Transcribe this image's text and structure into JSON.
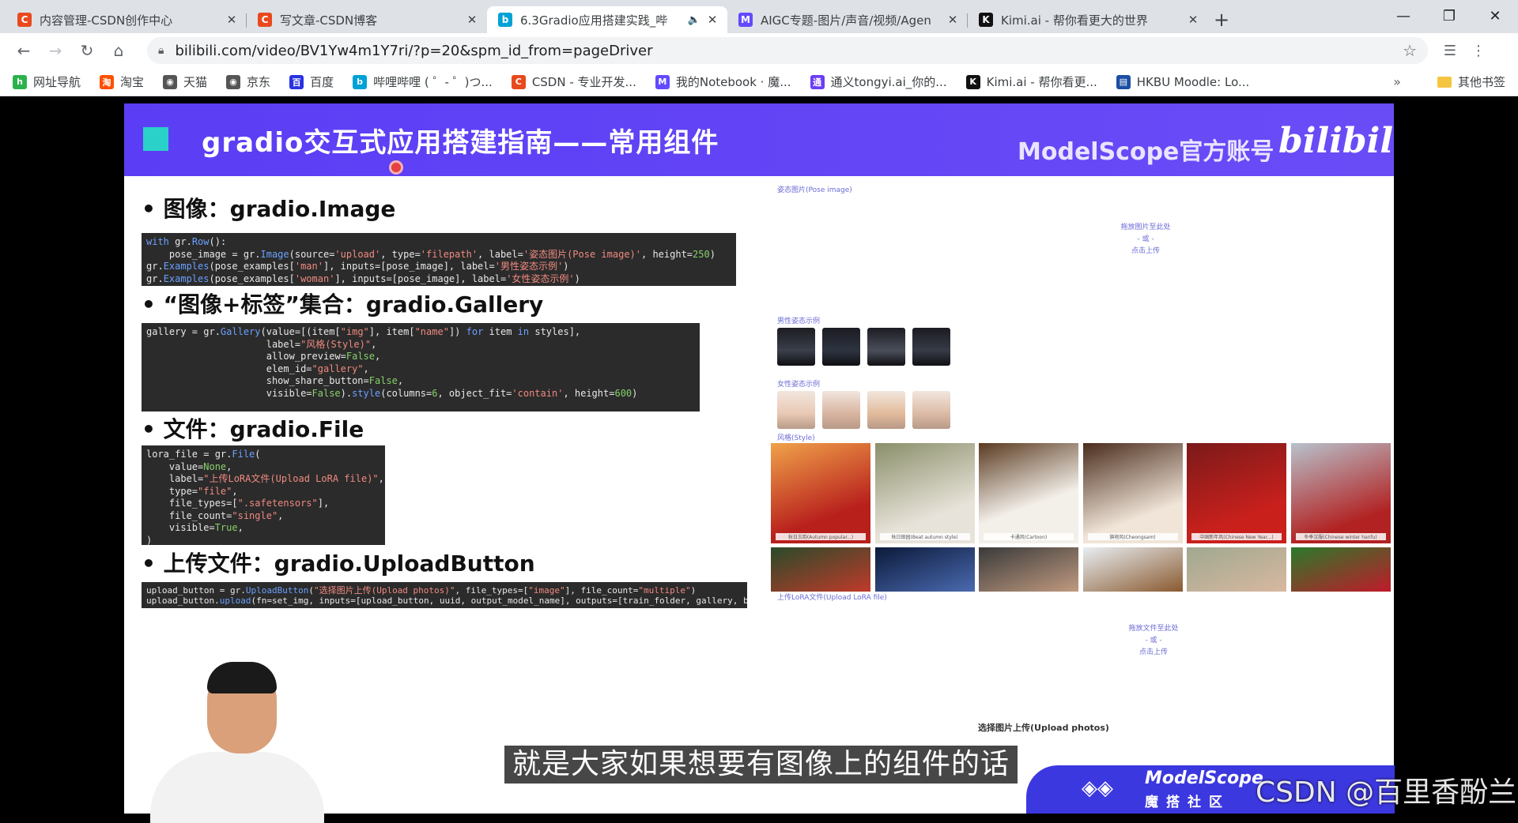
{
  "browser": {
    "tabs": [
      {
        "title": "内容管理-CSDN创作中心",
        "icon": "csdn-icon",
        "icon_color": "#e9491f",
        "icon_letter": "C"
      },
      {
        "title": "写文章-CSDN博客",
        "icon": "csdn-icon",
        "icon_color": "#e9491f",
        "icon_letter": "C"
      },
      {
        "title": "6.3Gradio应用搭建实践_哔",
        "icon": "bilibili-icon",
        "icon_color": "#00a1d6",
        "icon_letter": "b",
        "active": true,
        "audio": true
      },
      {
        "title": "AIGC专题-图片/声音/视频/Agen",
        "icon": "modelscope-icon",
        "icon_color": "#624aff",
        "icon_letter": "M"
      },
      {
        "title": "Kimi.ai - 帮你看更大的世界",
        "icon": "kimi-icon",
        "icon_color": "#111111",
        "icon_letter": "K"
      }
    ],
    "url": "bilibili.com/video/BV1Yw4m1Y7ri/?p=20&spm_id_from=pageDriver",
    "bookmarks": [
      {
        "label": "网址导航",
        "icon": "hao123-icon",
        "color": "#2bb24c",
        "letter": "h"
      },
      {
        "label": "淘宝",
        "icon": "taobao-icon",
        "color": "#ff5000",
        "letter": "淘"
      },
      {
        "label": "天猫",
        "icon": "globe-icon",
        "color": "#555555",
        "letter": "◉"
      },
      {
        "label": "京东",
        "icon": "globe-icon",
        "color": "#555555",
        "letter": "◉"
      },
      {
        "label": "百度",
        "icon": "baidu-icon",
        "color": "#2932e1",
        "letter": "百"
      },
      {
        "label": "哔哩哔哩 ( ゜- ゜)つ...",
        "icon": "bilibili-icon",
        "color": "#00a1d6",
        "letter": "b"
      },
      {
        "label": "CSDN - 专业开发...",
        "icon": "csdn-icon",
        "color": "#e9491f",
        "letter": "C"
      },
      {
        "label": "我的Notebook · 魔...",
        "icon": "modelscope-icon",
        "color": "#624aff",
        "letter": "M"
      },
      {
        "label": "通义tongyi.ai_你的...",
        "icon": "tongyi-icon",
        "color": "#6a3df5",
        "letter": "通"
      },
      {
        "label": "Kimi.ai - 帮你看更...",
        "icon": "kimi-icon",
        "color": "#111111",
        "letter": "K"
      },
      {
        "label": "HKBU Moodle: Lo...",
        "icon": "moodle-icon",
        "color": "#1c4fa3",
        "letter": "▤"
      }
    ],
    "other_bookmarks": "其他书签"
  },
  "slide": {
    "title": "gradio交互式应用搭建指南——常用组件",
    "brand": "ModelScope官方账号",
    "brand_logo": "bilibili",
    "sections": [
      {
        "heading": "• 图像：gradio.Image"
      },
      {
        "heading": "•  “图像+标签”集合：gradio.Gallery"
      },
      {
        "heading": "• 文件：gradio.File"
      },
      {
        "heading": "• 上传文件：gradio.UploadButton"
      }
    ],
    "demo": {
      "pose_label": "姿态图片(Pose image)",
      "drop_image_hint": [
        "拖放图片至此处",
        "- 或 -",
        "点击上传"
      ],
      "male_label": "男性姿态示例",
      "female_label": "女性姿态示例",
      "style_label": "风格(Style)",
      "gallery_captions": [
        "秋日古韵(Autumn popular...)",
        "秋日田园(Beat autumn style)",
        "卡通风(Cartoon)",
        "旗袍风(Cheongsam)",
        "中国新年风(Chinese New Year...)",
        "冬季汉服(Chinese winter hanfu)"
      ],
      "lora_label": "上传LoRA文件(Upload LoRA file)",
      "drop_file_hint": [
        "拖放文件至此处",
        "- 或 -",
        "点击上传"
      ],
      "upload_button": "选择图片上传(Upload photos)"
    }
  },
  "subtitle": "就是大家如果想要有图像上的组件的话",
  "modelscope_badge": {
    "name": "ModelScope",
    "cn": "魔搭社区"
  },
  "watermark": "CSDN @百里香酚兰"
}
